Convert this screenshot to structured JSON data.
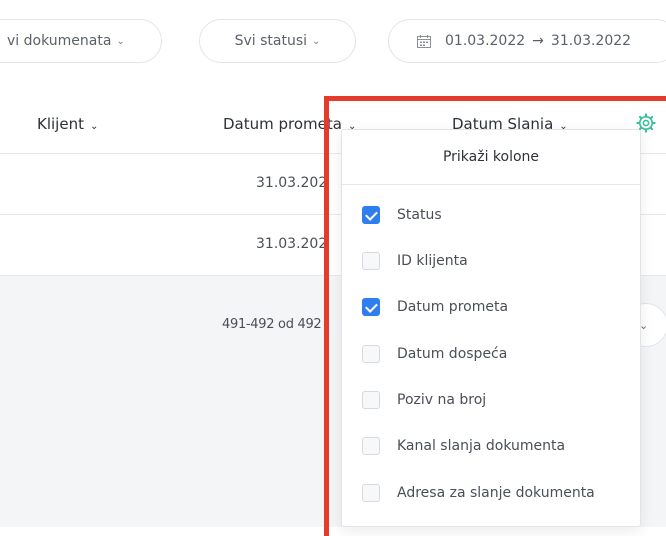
{
  "filters": {
    "type_label": "vi dokumenata",
    "status_label": "Svi statusi",
    "date_from": "01.03.2022",
    "date_arrow": "→",
    "date_to": "31.03.2022"
  },
  "table": {
    "columns": [
      "Klijent",
      "Datum prometa",
      "Datum Slanja"
    ],
    "rows": [
      {
        "datum_prometa": "31.03.202"
      },
      {
        "datum_prometa": "31.03.202"
      }
    ],
    "pagination": "491-492 od 492"
  },
  "column_picker": {
    "title": "Prikaži kolone",
    "options": [
      {
        "label": "Status",
        "checked": true
      },
      {
        "label": "ID klijenta",
        "checked": false
      },
      {
        "label": "Datum prometa",
        "checked": true
      },
      {
        "label": "Datum dospeća",
        "checked": false
      },
      {
        "label": "Poziv na broj",
        "checked": false
      },
      {
        "label": "Kanal slanja dokumenta",
        "checked": false
      },
      {
        "label": "Adresa za slanje dokumenta",
        "checked": false
      }
    ]
  },
  "colors": {
    "accent": "#2f7ef0",
    "gear": "#3bbf9a",
    "highlight": "#e53b2a"
  },
  "icons": {
    "chevron": "chevron-down-icon",
    "calendar": "calendar-icon",
    "settings": "gear-icon"
  }
}
